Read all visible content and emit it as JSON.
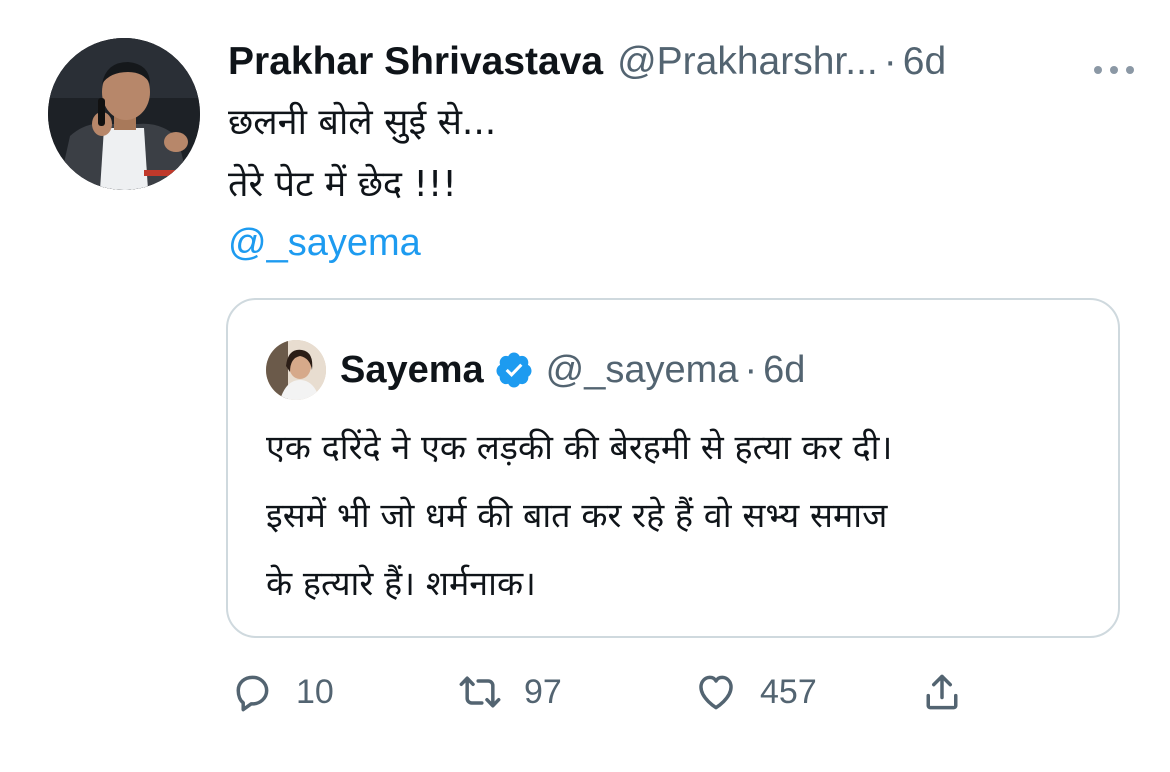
{
  "tweet": {
    "author_name": "Prakhar Shrivastava",
    "handle": "@Prakharshr...",
    "separator": "·",
    "time": "6d",
    "text_lines": [
      "छलनी बोले सुई से...",
      "तेरे पेट में छेद !!!"
    ],
    "mention": "@_sayema",
    "more_icon": "more-horizontal-icon"
  },
  "quote": {
    "author_name": "Sayema",
    "verified_icon": "verified-badge-icon",
    "handle": "@_sayema",
    "separator": "·",
    "time": "6d",
    "text_lines": [
      "एक दरिंदे ने एक लड़की की बेरहमी से हत्या कर दी।",
      "इसमें भी जो धर्म की बात कर रहे हैं वो सभ्य समाज",
      "के हत्यारे हैं। शर्मनाक।"
    ]
  },
  "actions": {
    "reply_count": "10",
    "retweet_count": "97",
    "like_count": "457",
    "reply_icon": "reply-icon",
    "retweet_icon": "retweet-icon",
    "like_icon": "heart-icon",
    "share_icon": "share-icon"
  },
  "colors": {
    "text": "#0f1419",
    "secondary": "#536471",
    "link": "#1d9bf0",
    "border": "#cfd9de"
  }
}
